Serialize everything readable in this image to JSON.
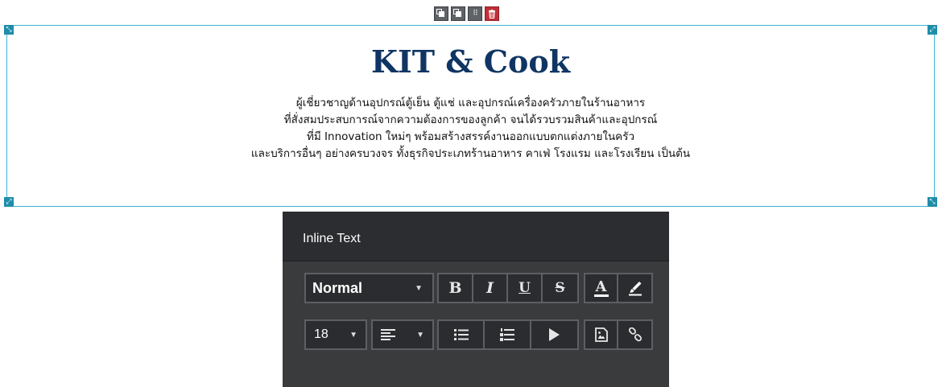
{
  "block_toolbar": {
    "buttons": [
      "clone-icon",
      "copy-icon",
      "grid-icon",
      "trash-icon"
    ]
  },
  "content": {
    "title": "KIT & Cook",
    "lines": [
      "ผู้เชี่ยวชาญด้านอุปกรณ์ตู้เย็น ตู้แช่ และอุปกรณ์เครื่องครัวภายในร้านอาหาร",
      "ที่สั่งสมประสบการณ์จากความต้องการของลูกค้า จนได้รวบรวมสินค้าและอุปกรณ์",
      "ที่มี Innovation ใหม่ๆ พร้อมสร้างสรรค์งานออกแบบตกแต่งภายในครัว",
      "และบริการอื่นๆ อย่างครบวงจร ทั้งธุรกิจประเภทร้านอาหาร คาเฟ่ โรงแรม และโรงเรียน เป็นต้น"
    ]
  },
  "editor": {
    "title": "Inline Text",
    "style_value": "Normal",
    "font_size": "18",
    "bold_label": "B",
    "italic_label": "I",
    "underline_label": "U",
    "strike_label": "S",
    "color_label": "A"
  },
  "colors": {
    "title": "#0f3563",
    "selection_border": "#3ab3cf",
    "editor_bg": "#3a3b3d",
    "delete_button": "#c0303a"
  }
}
